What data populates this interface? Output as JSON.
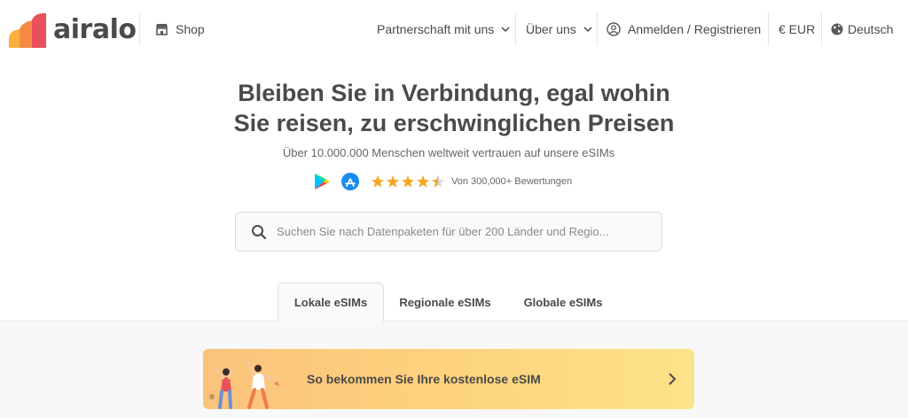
{
  "header": {
    "logo_text": "airalo",
    "shop_label": "Shop",
    "nav": {
      "partner_label": "Partnerschaft mit uns",
      "about_label": "Über uns",
      "login_label": "Anmelden / Registrieren",
      "currency_label": "€ EUR",
      "language_label": "Deutsch"
    }
  },
  "hero": {
    "title_line1": "Bleiben Sie in Verbindung, egal wohin",
    "title_line2": "Sie reisen, zu erschwinglichen Preisen",
    "subtitle": "Über 10.000.000 Menschen weltweit vertrauen auf unsere eSIMs",
    "rating": 4.5,
    "rating_text": "Von 300,000+ Bewertungen",
    "star_color": "#f5a623"
  },
  "search": {
    "placeholder": "Suchen Sie nach Datenpaketen für über 200 Länder und Regio..."
  },
  "tabs": [
    {
      "label": "Lokale eSIMs",
      "active": true
    },
    {
      "label": "Regionale eSIMs",
      "active": false
    },
    {
      "label": "Globale eSIMs",
      "active": false
    }
  ],
  "banner": {
    "text": "So bekommen Sie Ihre kostenlose eSIM"
  },
  "colors": {
    "brand_gradient": [
      "#f5a623",
      "#e8505b"
    ],
    "text": "#4a4a4a",
    "banner_start": "#fbc27b",
    "banner_end": "#fde389"
  }
}
